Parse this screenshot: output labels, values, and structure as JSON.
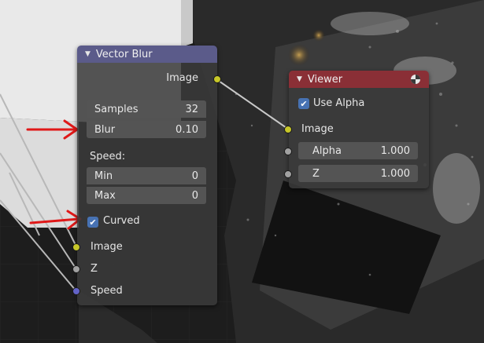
{
  "vector_blur": {
    "title": "Vector Blur",
    "output_image": "Image",
    "samples_label": "Samples",
    "samples_value": "32",
    "blur_label": "Blur",
    "blur_value": "0.10",
    "speed_label": "Speed:",
    "min_label": "Min",
    "min_value": "0",
    "max_label": "Max",
    "max_value": "0",
    "curved_label": "Curved",
    "input_image": "Image",
    "input_z": "Z",
    "input_speed": "Speed"
  },
  "viewer": {
    "title": "Viewer",
    "use_alpha_label": "Use Alpha",
    "input_image": "Image",
    "alpha_label": "Alpha",
    "alpha_value": "1.000",
    "z_label": "Z",
    "z_value": "1.000"
  },
  "colors": {
    "vector_blur_header": "#5b5b8a",
    "viewer_header": "#8a2f36",
    "socket_image": "#c7c729",
    "socket_value": "#a1a1a1",
    "socket_vector": "#6363c7",
    "annotation_arrow": "#e01818"
  }
}
